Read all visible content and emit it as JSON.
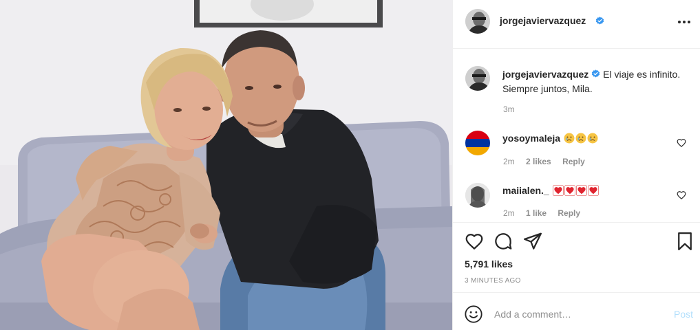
{
  "colors": {
    "text": "#262626",
    "secondary": "#8e8e8e",
    "verified": "#3897f0",
    "heart_red": "#ed4956",
    "post_disabled": "#b2dffc",
    "border": "#efefef"
  },
  "icons": {
    "verified": "verified-badge-icon",
    "more": "more-options-icon",
    "like": "heart-outline-icon",
    "comment": "speech-bubble-icon",
    "share": "paper-plane-icon",
    "save": "bookmark-icon",
    "emoji": "smiley-face-icon"
  },
  "header": {
    "username": "jorgejaviervazquez"
  },
  "caption": {
    "username": "jorgejaviervazquez",
    "text": "El viaje es infinito. Siempre juntos, Mila.",
    "time": "3m"
  },
  "comments": [
    {
      "username": "yosoymaleja",
      "text": "",
      "emojis": [
        "crying-face",
        "crying-face",
        "crying-face"
      ],
      "time": "2m",
      "likes": "2 likes",
      "reply": "Reply"
    },
    {
      "username": "maiialen._",
      "text": "",
      "emojis": [
        "red-heart",
        "red-heart",
        "red-heart",
        "red-heart"
      ],
      "time": "2m",
      "likes": "1 like",
      "reply": "Reply"
    }
  ],
  "stats": {
    "likes": "5,791 likes",
    "posted": "3 MINUTES AGO"
  },
  "add_comment": {
    "placeholder": "Add a comment…",
    "post_label": "Post"
  }
}
